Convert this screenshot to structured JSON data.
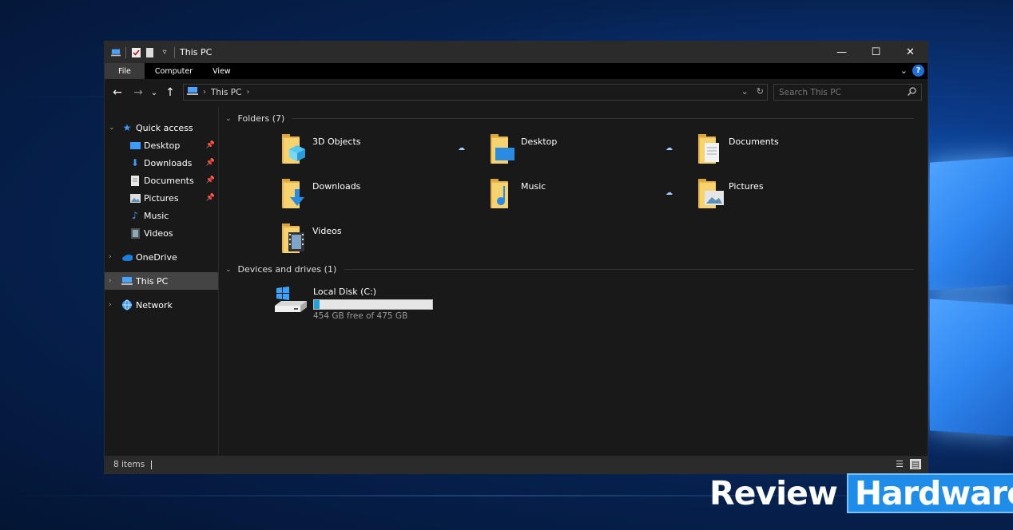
{
  "window": {
    "title": "This PC"
  },
  "window_controls": {
    "minimize": "—",
    "maximize": "☐",
    "close": "✕"
  },
  "ribbon": {
    "tabs": [
      "File",
      "Computer",
      "View"
    ]
  },
  "address": {
    "crumb": "This PC"
  },
  "search": {
    "placeholder": "Search This PC"
  },
  "sidebar": {
    "quick_access": "Quick access",
    "pinned": [
      "Desktop",
      "Downloads",
      "Documents",
      "Pictures"
    ],
    "others": [
      "Music",
      "Videos"
    ],
    "onedrive": "OneDrive",
    "this_pc": "This PC",
    "network": "Network"
  },
  "main": {
    "folders_header": "Folders (7)",
    "folders": [
      "3D Objects",
      "Desktop",
      "Documents",
      "Downloads",
      "Music",
      "Pictures",
      "Videos"
    ],
    "devices_header": "Devices and drives (1)",
    "drive": {
      "name": "Local Disk (C:)",
      "free_text": "454 GB free of 475 GB",
      "used_fraction": 0.044
    }
  },
  "status": {
    "count": "8 items"
  },
  "watermark": {
    "left": "Review",
    "right": "Hardware"
  },
  "colors": {
    "accent": "#26a0da",
    "folder": "#f6d36f",
    "selection": "#444444"
  }
}
